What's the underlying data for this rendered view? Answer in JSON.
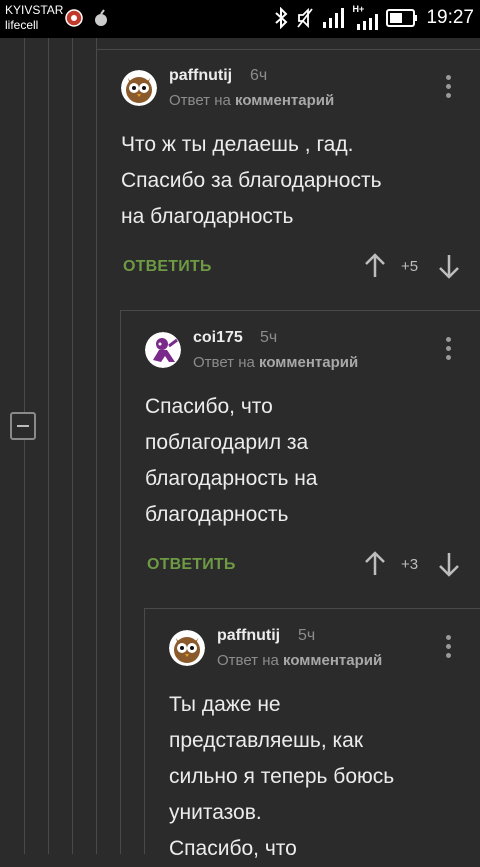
{
  "status_bar": {
    "carrier1": "KYIVSTAR",
    "carrier2": "lifecell",
    "network": "H+",
    "time": "19:27"
  },
  "comments": [
    {
      "username": "paffnutij",
      "age": "6ч",
      "reply_prefix": "Ответ на",
      "reply_target": "комментарий",
      "text": "Что ж ты делаешь , гад.\nСпасибо за благодарность\nна благодарность",
      "reply_label": "ОТВЕТИТЬ",
      "score": "+5",
      "avatar_icon": "owl-avatar-brown"
    },
    {
      "username": "coi175",
      "age": "5ч",
      "reply_prefix": "Ответ на",
      "reply_target": "комментарий",
      "text": "Спасибо, что\nпоблагодарил за\nблагодарность на\nблагодарность",
      "reply_label": "ОТВЕТИТЬ",
      "score": "+3",
      "avatar_icon": "purple-figure-avatar"
    },
    {
      "username": "paffnutij",
      "age": "5ч",
      "reply_prefix": "Ответ на",
      "reply_target": "комментарий",
      "text": "Ты даже не\nпредставляешь, как\nсильно я теперь боюсь\nунитазов.\nСпасибо, что",
      "avatar_icon": "owl-avatar-brown"
    }
  ],
  "colors": {
    "background": "#2b2b2b",
    "reply_green": "#6e9a44",
    "muted": "#8c8c8c"
  }
}
